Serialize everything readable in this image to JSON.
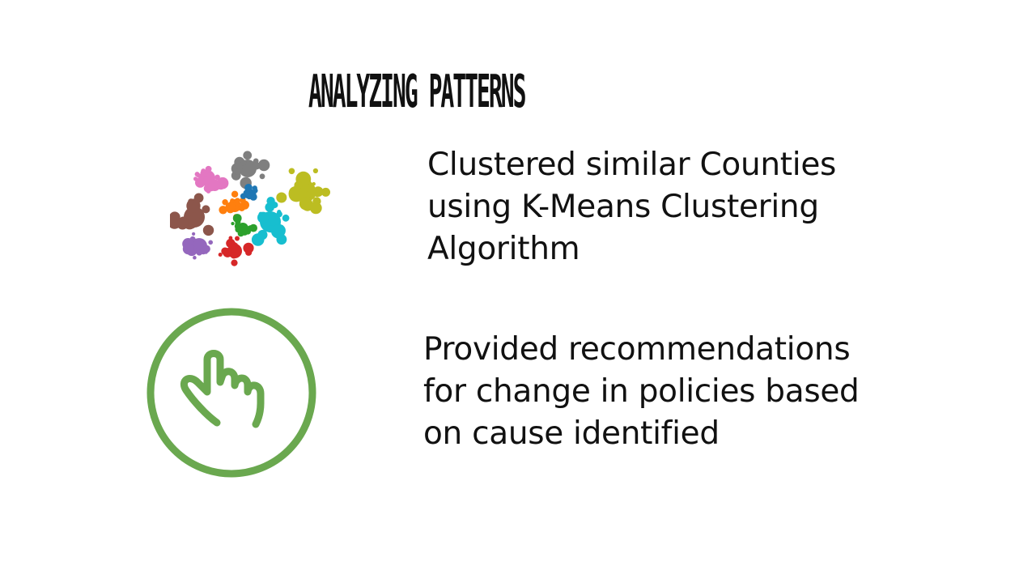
{
  "slide": {
    "title": "ANALYZING PATTERNS",
    "items": [
      {
        "icon": "cluster-bubbles-icon",
        "lines": [
          "Clustered similar Counties",
          "using K-Means Clustering",
          "Algorithm"
        ]
      },
      {
        "icon": "pointing-hand-icon",
        "lines": [
          "Provided recommendations",
          "for change in policies based",
          "on cause identified"
        ]
      }
    ]
  },
  "colors": {
    "text": "#111111",
    "hand_icon": "#6aa84f",
    "cluster_pink": "#e377c2",
    "cluster_gray": "#7f7f7f",
    "cluster_olive": "#bcbd22",
    "cluster_brown": "#8c564b",
    "cluster_orange": "#ff7f0e",
    "cluster_blue": "#1f77b4",
    "cluster_cyan": "#17becf",
    "cluster_green": "#2ca02c",
    "cluster_purple": "#9467bd",
    "cluster_red": "#d62728"
  }
}
